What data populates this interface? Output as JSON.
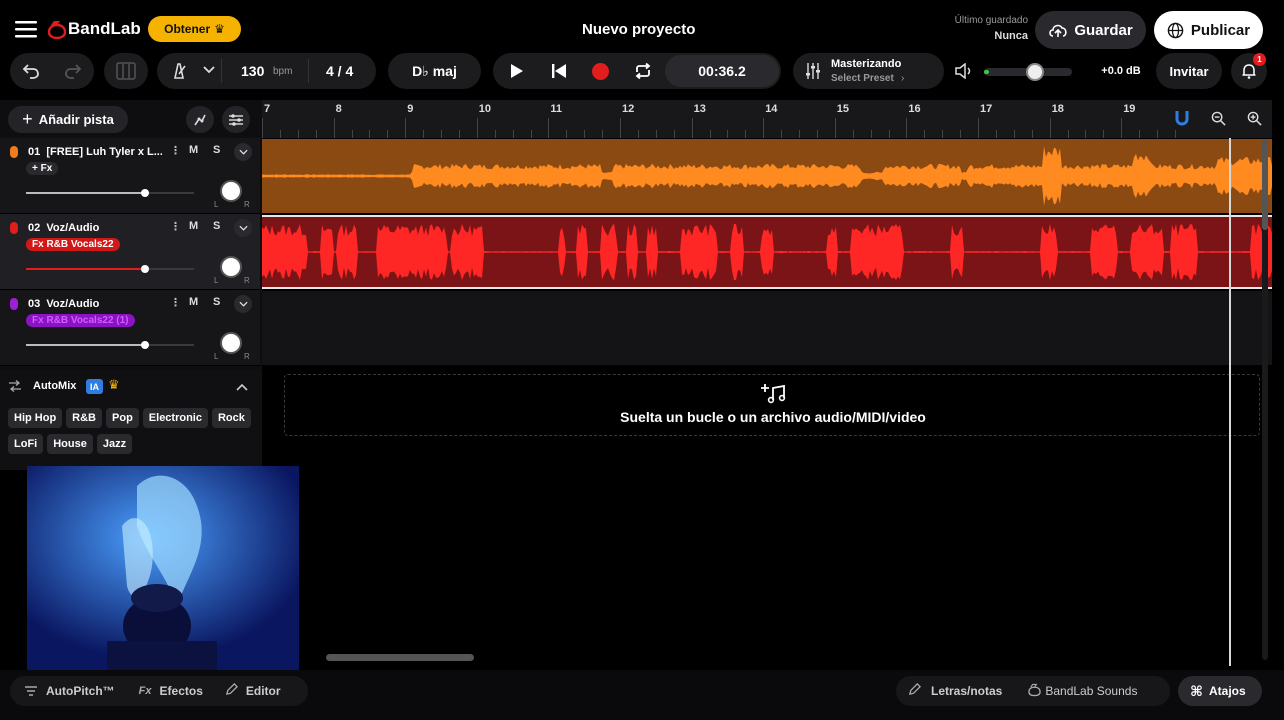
{
  "header": {
    "logo_text": "BandLab",
    "get_button": "Obtener",
    "project_title": "Nuevo proyecto",
    "last_saved_label": "Último guardado",
    "last_saved_value": "Nunca",
    "save_button": "Guardar",
    "publish_button": "Publicar",
    "notification_count": "1"
  },
  "toolbar": {
    "tempo_value": "130",
    "tempo_unit": "bpm",
    "time_signature": "4 / 4",
    "key": "D♭ maj",
    "time_display": "00:36.2",
    "mastering_title": "Masterizando",
    "mastering_preset": "Select Preset",
    "volume_db": "+0.0 dB",
    "invite_button": "Invitar",
    "master_volume_fraction": 0.58
  },
  "left_panel": {
    "add_track_button": "Añadir pista"
  },
  "tracks": [
    {
      "number": "01",
      "name": "[FREE] Luh Tyler x L...",
      "fx": "+ Fx",
      "color": "#f07a1e",
      "volume_fraction": 0.71
    },
    {
      "number": "02",
      "name": "Voz/Audio",
      "fx": "Fx R&B Vocals22",
      "color": "#e11d1d",
      "volume_fraction": 0.71
    },
    {
      "number": "03",
      "name": "Voz/Audio",
      "fx": "Fx R&B Vocals22 (1)",
      "color": "#9d1fd6",
      "volume_fraction": 0.71
    }
  ],
  "track_controls": {
    "mute": "M",
    "solo": "S",
    "left": "L",
    "right": "R"
  },
  "automix": {
    "title": "AutoMix",
    "ai_badge": "IA",
    "genres": [
      "Hip Hop",
      "R&B",
      "Pop",
      "Electronic",
      "Rock",
      "LoFi",
      "House",
      "Jazz"
    ]
  },
  "timeline": {
    "ruler_labels": [
      "7",
      "8",
      "9",
      "10",
      "11",
      "12",
      "13",
      "14",
      "15",
      "16",
      "17",
      "18",
      "19"
    ],
    "drop_zone_text": "Suelta un bucle o un archivo audio/MIDI/video"
  },
  "bottom_bar": {
    "autopitch": "AutoPitch™",
    "effects": "Efectos",
    "effects_prefix": "Fx",
    "editor": "Editor",
    "lyrics": "Letras/notas",
    "sounds": "BandLab Sounds",
    "shortcuts": "Atajos"
  },
  "colors": {
    "accent": "#f5b300",
    "track1": "#f07a1e",
    "track2": "#e11d1d",
    "track3": "#9d1fd6",
    "record": "#e11d1d"
  }
}
